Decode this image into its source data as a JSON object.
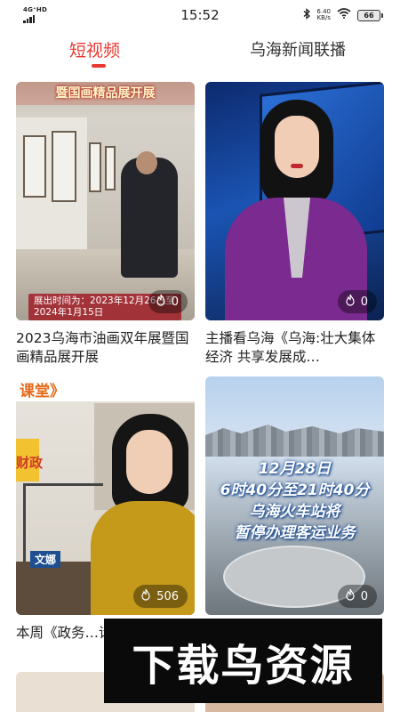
{
  "status": {
    "network": "4G⁺HD",
    "time": "15:52",
    "speed_value": "6.40",
    "speed_unit": "KB/s",
    "battery": "66"
  },
  "tabs": [
    {
      "label": "短视频",
      "active": true
    },
    {
      "label": "乌海新闻联播",
      "active": false
    }
  ],
  "videos": [
    {
      "caption": "2023乌海市油画双年展暨国画精品展开展",
      "likes": "0",
      "banner": "暨国画精品展开展",
      "overlay_line1": "展出时间为：2023年12月26日至",
      "overlay_line2": "2024年1月15日"
    },
    {
      "caption": "主播看乌海《乌海:壮大集体经济 共享发展成…",
      "likes": "0"
    },
    {
      "caption": "本周《政务…请乌海市财…",
      "likes": "506",
      "topbar": "课堂》",
      "side": "财政",
      "name": "文娜"
    },
    {
      "caption": "",
      "likes": "0",
      "overlay_line1": "12月28日",
      "overlay_line2": "6时40分至21时40分",
      "overlay_line3": "乌海火车站将",
      "overlay_line4": "暂停办理客运业务"
    }
  ],
  "watermark": "下载鸟资源",
  "colors": {
    "accent": "#e8372f"
  }
}
